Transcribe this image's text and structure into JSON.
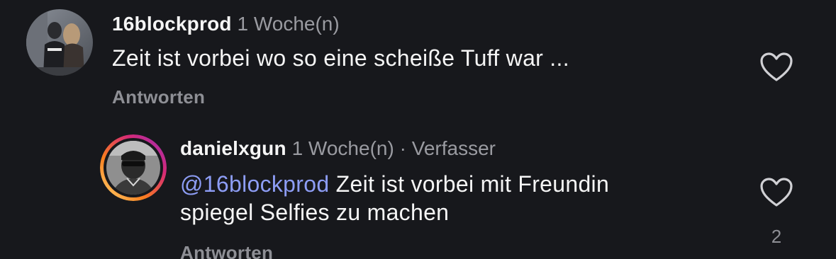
{
  "comments": [
    {
      "username": "16blockprod",
      "time": "1 Woche(n)",
      "text": "Zeit ist vorbei wo so eine scheiße Tuff war ...",
      "reply_label": "Antworten",
      "like_icon": "heart-outline-icon"
    }
  ],
  "replies": [
    {
      "username": "danielxgun",
      "time": "1 Woche(n)",
      "separator": "·",
      "author_tag": "Verfasser",
      "mention": "@16blockprod",
      "text_line1": " Zeit ist vorbei mit Freundin",
      "text_line2": "spiegel Selfies zu machen",
      "reply_label": "Antworten",
      "like_icon": "heart-outline-icon",
      "like_count": "2",
      "story_ring_colors": [
        "#feda75",
        "#fa7e1e",
        "#d62976",
        "#962fbf"
      ]
    }
  ],
  "colors": {
    "background": "#17181c",
    "primary_text": "#f5f5f5",
    "secondary_text": "#9a9ba1",
    "mention": "#8d9df5"
  }
}
